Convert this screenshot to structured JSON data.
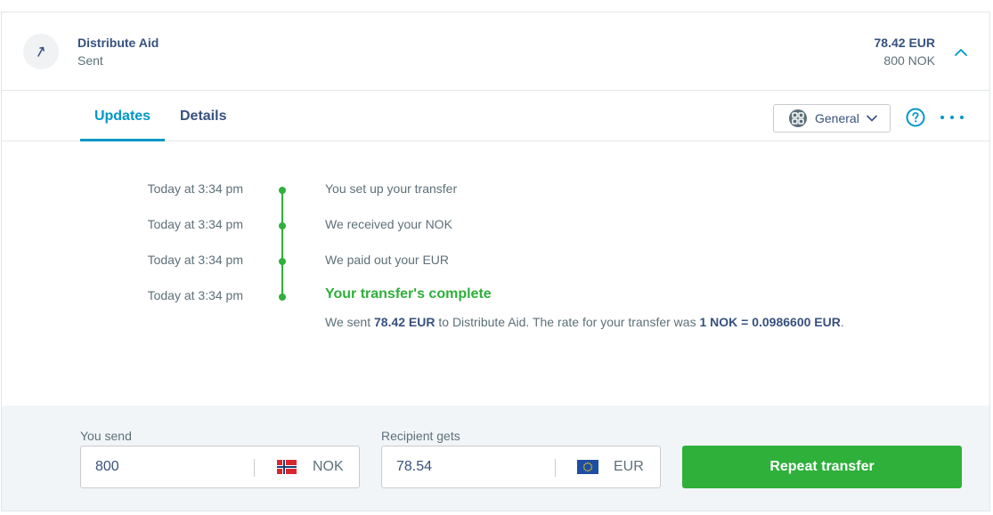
{
  "header": {
    "title": "Distribute Aid",
    "status": "Sent",
    "amount_target": "78.42 EUR",
    "amount_source": "800 NOK",
    "icon": "arrow-up-right-icon",
    "collapse_icon": "chevron-up-icon"
  },
  "tabs": [
    {
      "label": "Updates",
      "active": true
    },
    {
      "label": "Details",
      "active": false
    }
  ],
  "toolbar": {
    "category_label": "General",
    "category_icon": "category-grid-icon",
    "help_icon": "help-icon",
    "more_icon": "more-dots-icon"
  },
  "timeline": [
    {
      "time": "Today at 3:34 pm",
      "text": "You set up your transfer"
    },
    {
      "time": "Today at 3:34 pm",
      "text": "We received your NOK"
    },
    {
      "time": "Today at 3:34 pm",
      "text": "We paid out your EUR"
    },
    {
      "time": "Today at 3:34 pm",
      "text": "Your transfer's complete"
    }
  ],
  "detail": {
    "part1": "We sent ",
    "amount": "78.42 EUR",
    "part2": " to Distribute Aid. The rate for your transfer was ",
    "rate": "1 NOK = 0.0986600 EUR",
    "part3": "."
  },
  "footer": {
    "send_label": "You send",
    "send_value": "800",
    "send_currency": "NOK",
    "receive_label": "Recipient gets",
    "receive_value": "78.54",
    "receive_currency": "EUR",
    "repeat_label": "Repeat transfer"
  },
  "colors": {
    "accent": "#0097c7",
    "success": "#2eb03a",
    "text": "#37517e",
    "muted": "#5d7079"
  }
}
